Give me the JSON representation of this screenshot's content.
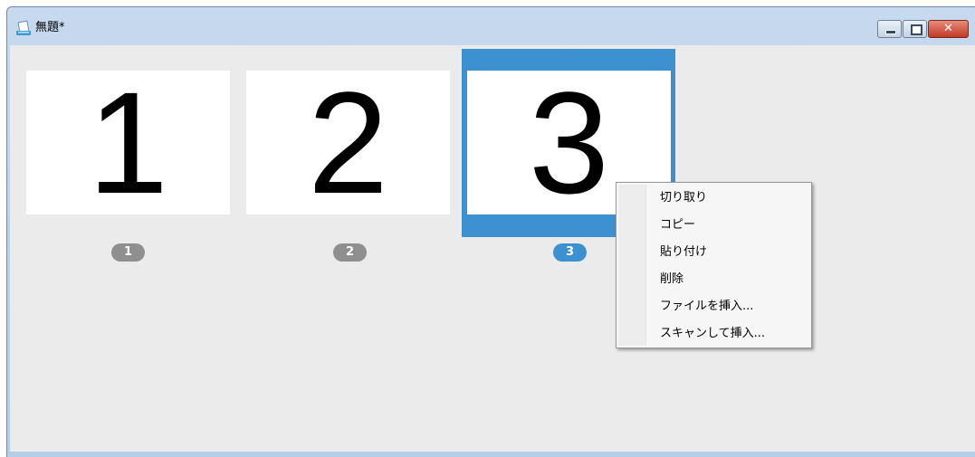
{
  "window": {
    "title": "無題*",
    "controls": {
      "minimize": "minimize",
      "maximize": "maximize",
      "close": "✕"
    }
  },
  "pages": [
    {
      "content": "1",
      "badge": "1",
      "selected": false
    },
    {
      "content": "2",
      "badge": "2",
      "selected": false
    },
    {
      "content": "3",
      "badge": "3",
      "selected": true
    }
  ],
  "context_menu": {
    "items": [
      {
        "label": "切り取り"
      },
      {
        "label": "コピー"
      },
      {
        "label": "貼り付け"
      },
      {
        "label": "削除"
      },
      {
        "label": "ファイルを挿入..."
      },
      {
        "label": "スキャンして挿入..."
      }
    ]
  },
  "colors": {
    "selection_accent": "#3d91d0",
    "badge_inactive": "#8f8f8f",
    "client_background": "#ebebeb"
  },
  "icons": {
    "app": "scanner-app-icon"
  }
}
